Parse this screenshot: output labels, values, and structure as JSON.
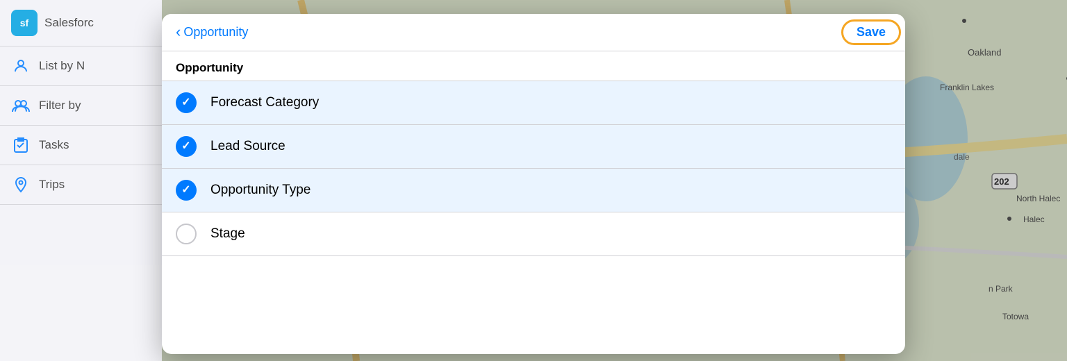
{
  "sidebar": {
    "logo_text": "sf",
    "title": "Salesforc",
    "items": [
      {
        "id": "list-by",
        "label": "List by N",
        "icon": "person-icon"
      },
      {
        "id": "filter-by",
        "label": "Filter by",
        "icon": "group-icon"
      },
      {
        "id": "tasks",
        "label": "Tasks",
        "icon": "clipboard-icon"
      },
      {
        "id": "trips",
        "label": "Trips",
        "icon": "location-icon"
      }
    ]
  },
  "modal": {
    "back_label": "Opportunity",
    "save_label": "Save",
    "section_title": "Opportunity",
    "items": [
      {
        "id": "forecast-category",
        "label": "Forecast Category",
        "selected": true
      },
      {
        "id": "lead-source",
        "label": "Lead Source",
        "selected": true
      },
      {
        "id": "opportunity-type",
        "label": "Opportunity Type",
        "selected": true
      },
      {
        "id": "stage",
        "label": "Stage",
        "selected": false
      }
    ]
  },
  "colors": {
    "accent": "#007aff",
    "highlight": "#f5a623",
    "selected_bg": "#eaf4ff"
  }
}
